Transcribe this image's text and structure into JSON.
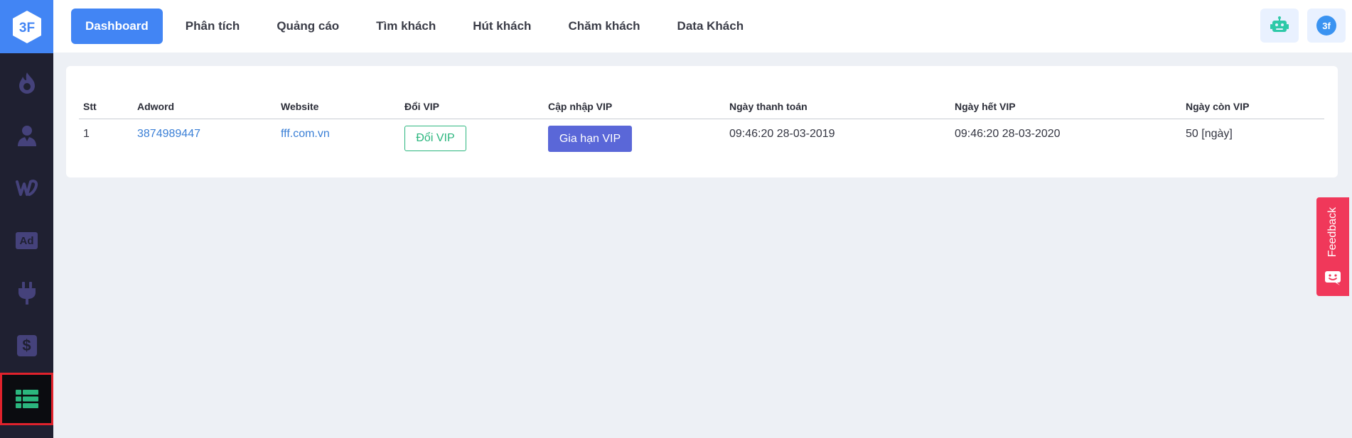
{
  "app": {
    "logo_text": "3F"
  },
  "sidebar": {
    "items": [
      {
        "icon": "fire-icon"
      },
      {
        "icon": "user-icon"
      },
      {
        "icon": "weebly-w-icon"
      },
      {
        "icon": "ad-icon",
        "label": "Ad"
      },
      {
        "icon": "plug-icon"
      },
      {
        "icon": "dollar-icon",
        "label": "$"
      },
      {
        "icon": "table-list-icon",
        "active": true
      }
    ]
  },
  "nav": {
    "items": [
      {
        "label": "Dashboard",
        "active": true
      },
      {
        "label": "Phân tích"
      },
      {
        "label": "Quảng cáo"
      },
      {
        "label": "Tìm khách"
      },
      {
        "label": "Hút khách"
      },
      {
        "label": "Chăm khách"
      },
      {
        "label": "Data Khách"
      }
    ]
  },
  "header": {
    "bot_icon": "robot-icon",
    "avatar_text": "3f"
  },
  "table": {
    "columns": [
      "Stt",
      "Adword",
      "Website",
      "Đổi VIP",
      "Cập nhập VIP",
      "Ngày thanh toán",
      "Ngày hết VIP",
      "Ngày còn VIP"
    ],
    "rows": [
      {
        "stt": "1",
        "adword": "3874989447",
        "website": "fff.com.vn",
        "change_vip_label": "Đổi VIP",
        "renew_vip_label": "Gia hạn VIP",
        "payment_date": "09:46:20 28-03-2019",
        "expiry_date": "09:46:20 28-03-2020",
        "days_left": "50 [ngày]"
      }
    ]
  },
  "feedback": {
    "label": "Feedback",
    "icon": "smiley-chat-icon"
  },
  "colors": {
    "accent": "#4285f4",
    "sidebar_bg": "#1f2031",
    "primary_button": "#5a67d8",
    "success": "#2bb67e",
    "feedback": "#f0385a",
    "highlight_border": "#e0222c"
  }
}
